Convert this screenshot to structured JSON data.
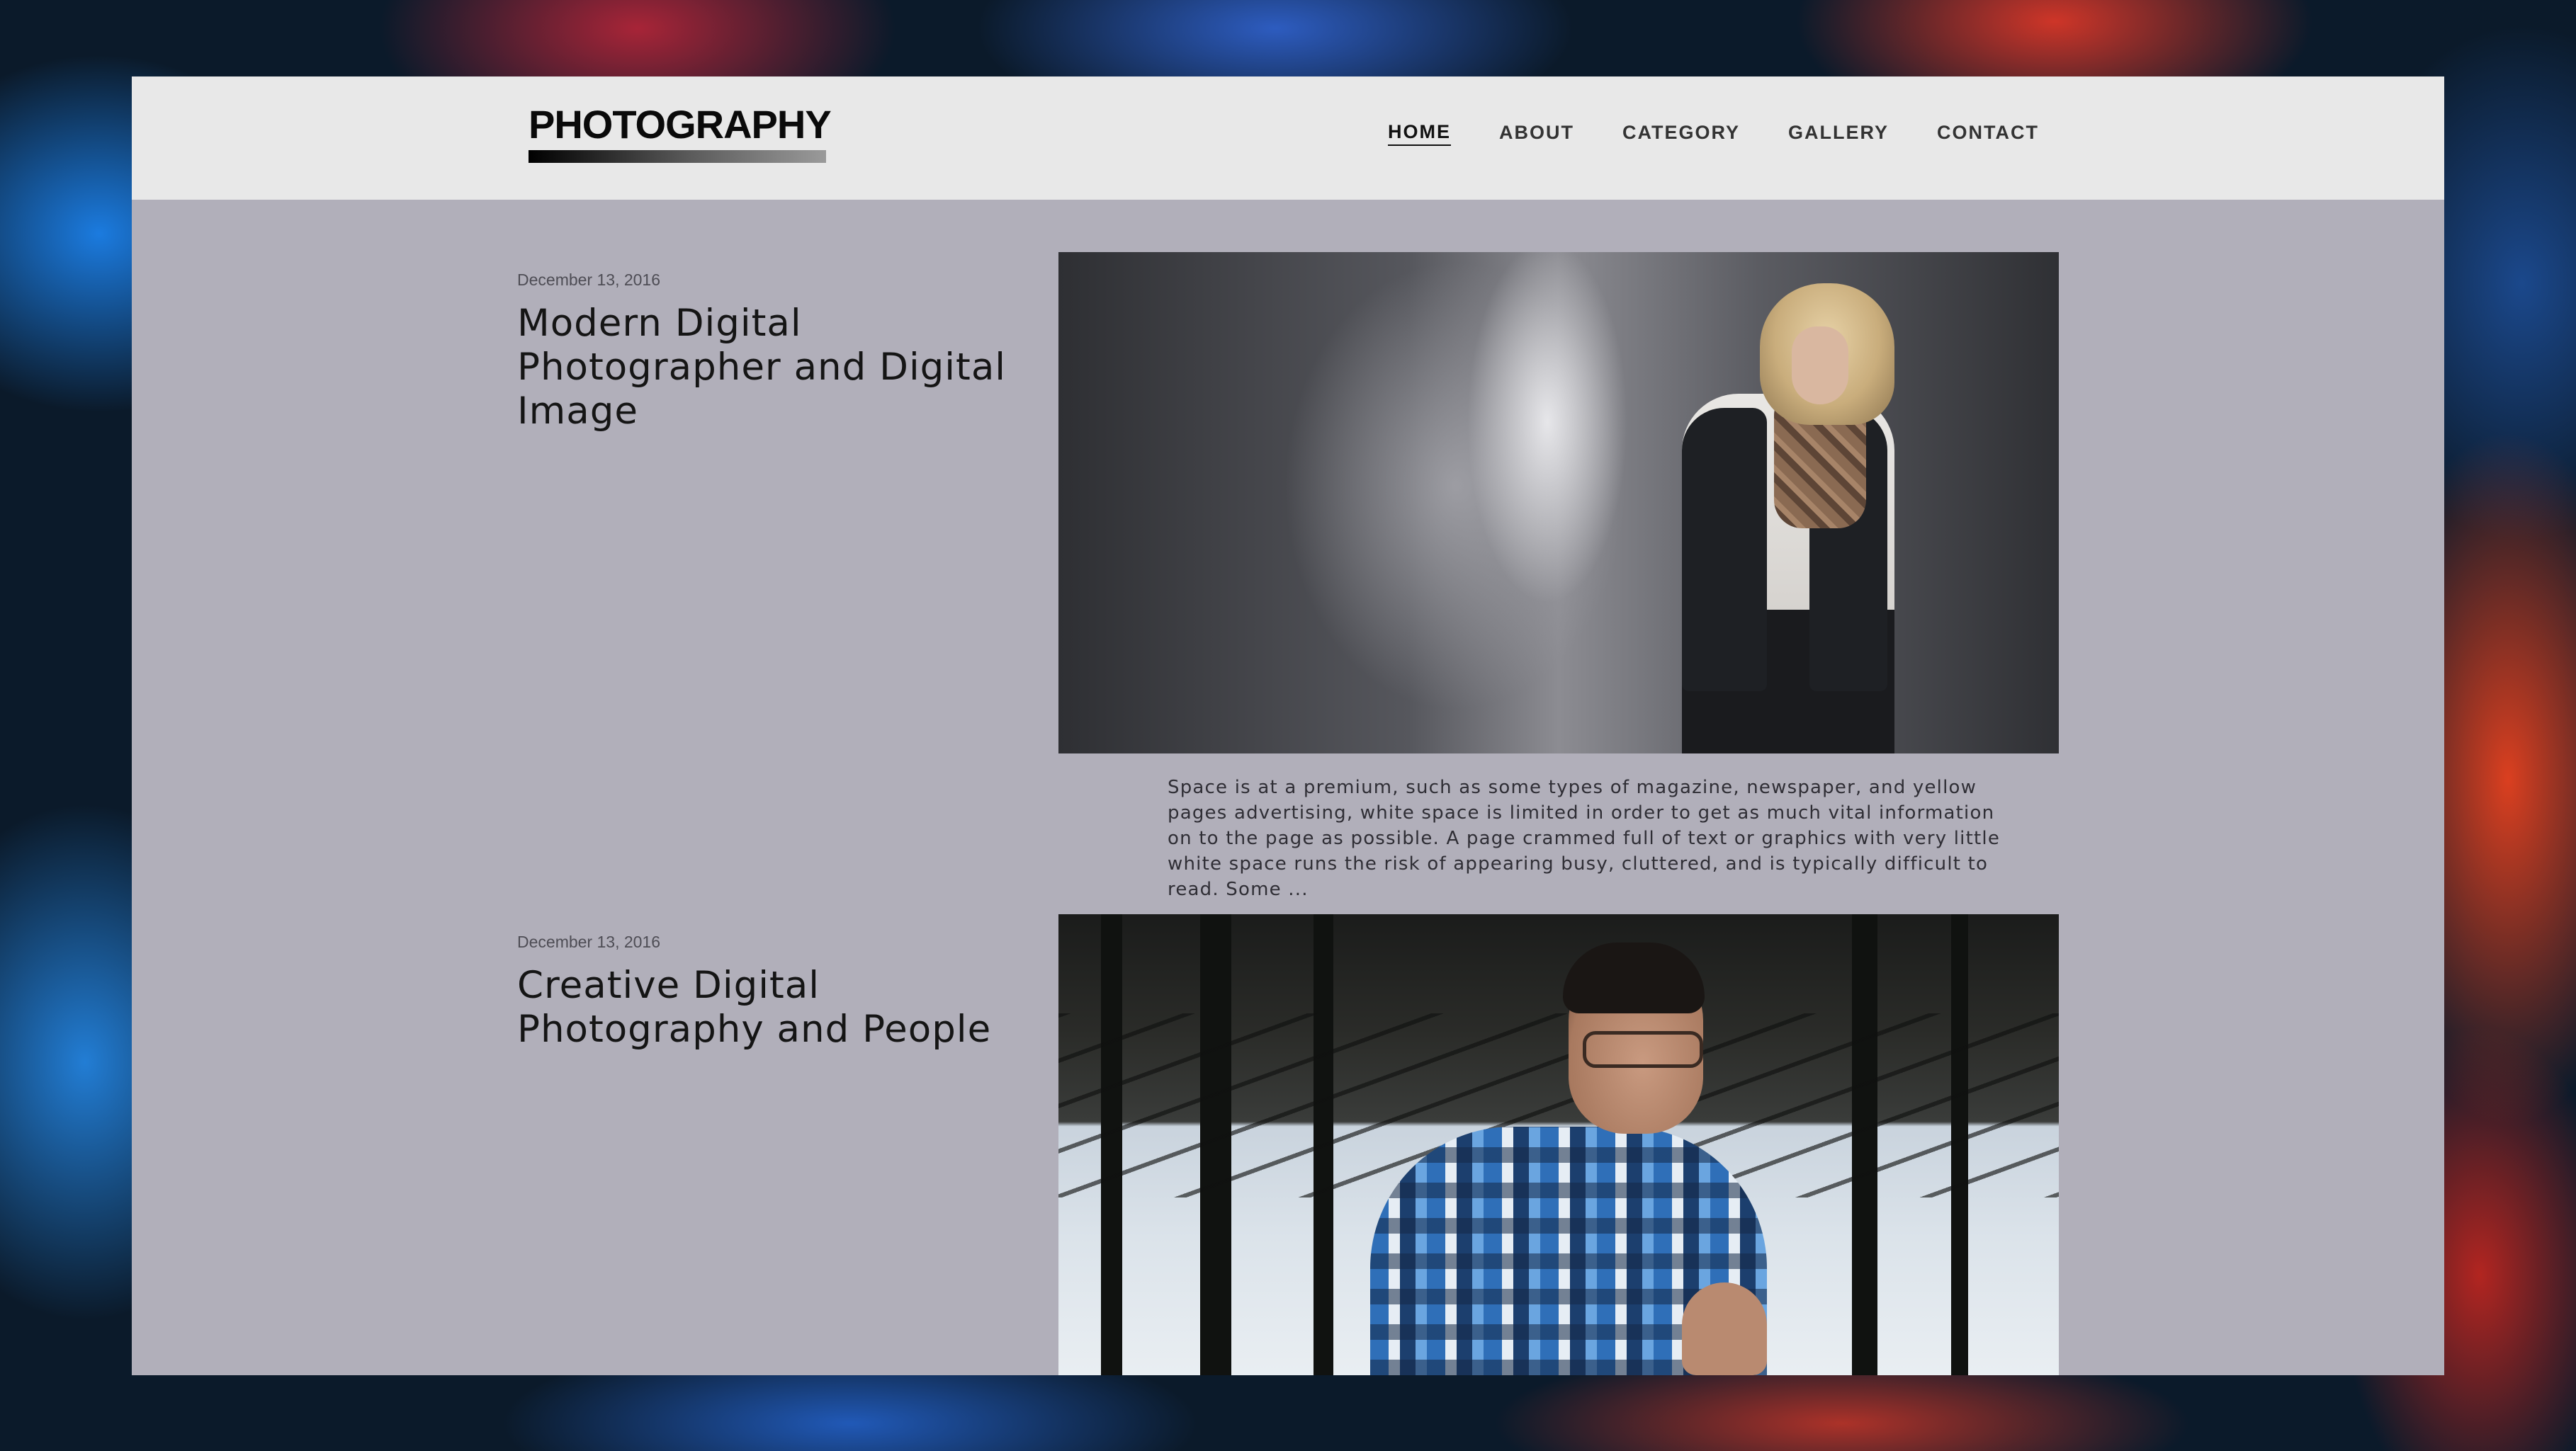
{
  "header": {
    "logo_text": "PHOTOGRAPHY",
    "nav": [
      {
        "label": "HOME",
        "active": true
      },
      {
        "label": "ABOUT",
        "active": false
      },
      {
        "label": "CATEGORY",
        "active": false
      },
      {
        "label": "GALLERY",
        "active": false
      },
      {
        "label": "CONTACT",
        "active": false
      }
    ]
  },
  "posts": [
    {
      "date": "December 13, 2016",
      "title": "Modern Digital Photographer and Digital Image",
      "image": "woman-with-scarf-photo",
      "excerpt": "Space is at a premium, such as some types of magazine, newspaper, and yellow pages advertising, white space is limited in order to get as much vital information on to the page as possible. A page crammed full of text or graphics with very little white space runs the risk of appearing busy, cluttered, and is typically difficult to read. Some ..."
    },
    {
      "date": "December 13, 2016",
      "title": "Creative Digital Photography and People",
      "image": "man-in-plaid-shirt-photo"
    }
  ],
  "colors": {
    "header_bg": "#e8e8e8",
    "content_bg": "#b1afba",
    "text_dark": "#151515",
    "text_muted": "#4e4d55"
  }
}
